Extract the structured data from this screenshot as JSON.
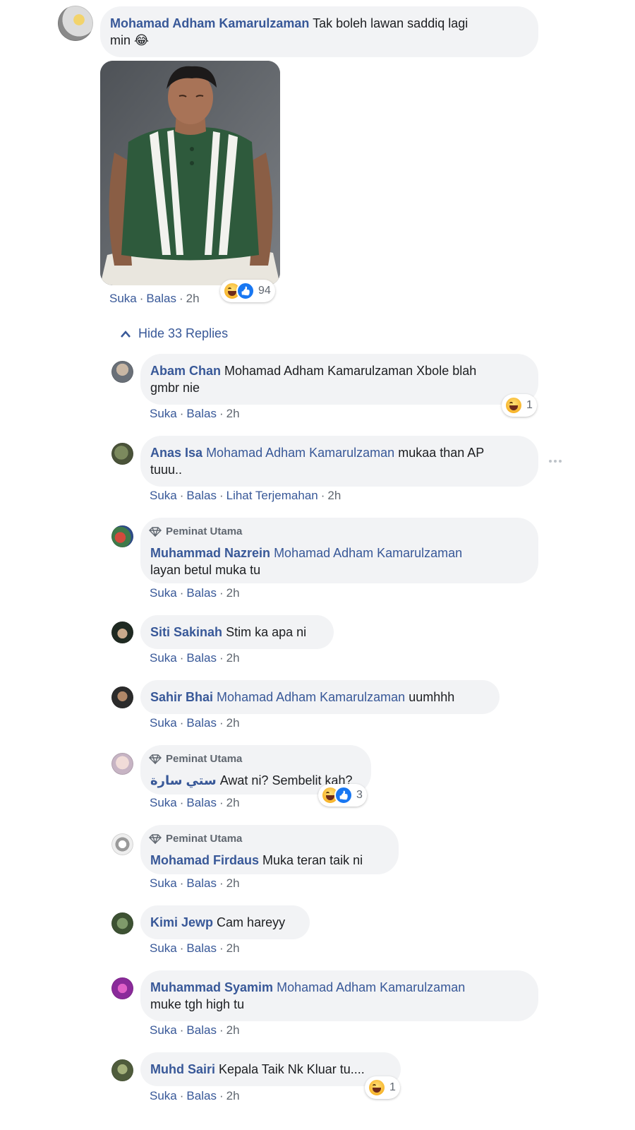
{
  "main_comment": {
    "name": "Mohamad Adham Kamarulzaman",
    "text": "Tak boleh lawan saddiq lagi",
    "text_line2": "min",
    "emoji": "😂",
    "actions": {
      "like": "Suka",
      "reply": "Balas",
      "time": "2h"
    },
    "reactions": {
      "icons": [
        "haha-icon",
        "like-icon"
      ],
      "count": "94"
    }
  },
  "replies_toggle": {
    "label": "Hide 33 Replies"
  },
  "replies": [
    {
      "name": "Abam Chan",
      "tag": "",
      "text": "Mohamad Adham Kamarulzaman Xbole blah",
      "text_line2": "gmbr nie",
      "actions": {
        "like": "Suka",
        "reply": "Balas",
        "time": "2h"
      },
      "reaction_count": "1"
    },
    {
      "name": "Anas Isa",
      "tag": "Mohamad Adham Kamarulzaman",
      "text": "mukaa than AP",
      "text_line2": "tuuu..",
      "actions": {
        "like": "Suka",
        "reply": "Balas",
        "translate": "Lihat Terjemahan",
        "time": "2h"
      }
    },
    {
      "badge": "Peminat Utama",
      "name": "Muhammad Nazrein",
      "tag": "Mohamad Adham Kamarulzaman",
      "text_line2": "layan betul muka tu",
      "actions": {
        "like": "Suka",
        "reply": "Balas",
        "time": "2h"
      }
    },
    {
      "name": "Siti Sakinah",
      "text": "Stim ka apa ni",
      "actions": {
        "like": "Suka",
        "reply": "Balas",
        "time": "2h"
      }
    },
    {
      "name": "Sahir Bhai",
      "tag": "Mohamad Adham Kamarulzaman",
      "text": "uumhhh",
      "actions": {
        "like": "Suka",
        "reply": "Balas",
        "time": "2h"
      }
    },
    {
      "badge": "Peminat Utama",
      "name": "ستي سارة",
      "text": "Awat ni? Sembelit kah?",
      "actions": {
        "like": "Suka",
        "reply": "Balas",
        "time": "2h"
      },
      "reaction_count": "3"
    },
    {
      "badge": "Peminat Utama",
      "name": "Mohamad Firdaus",
      "text": "Muka teran taik ni",
      "actions": {
        "like": "Suka",
        "reply": "Balas",
        "time": "2h"
      }
    },
    {
      "name": "Kimi Jewp",
      "text": "Cam hareyy",
      "actions": {
        "like": "Suka",
        "reply": "Balas",
        "time": "2h"
      }
    },
    {
      "name": "Muhammad Syamim",
      "tag": "Mohamad Adham Kamarulzaman",
      "text_line2": "muke tgh high tu",
      "actions": {
        "like": "Suka",
        "reply": "Balas",
        "time": "2h"
      }
    },
    {
      "name": "Muhd Sairi",
      "text": "Kepala Taik Nk Kluar tu....",
      "actions": {
        "like": "Suka",
        "reply": "Balas",
        "time": "2h"
      },
      "reaction_count": "1"
    }
  ]
}
